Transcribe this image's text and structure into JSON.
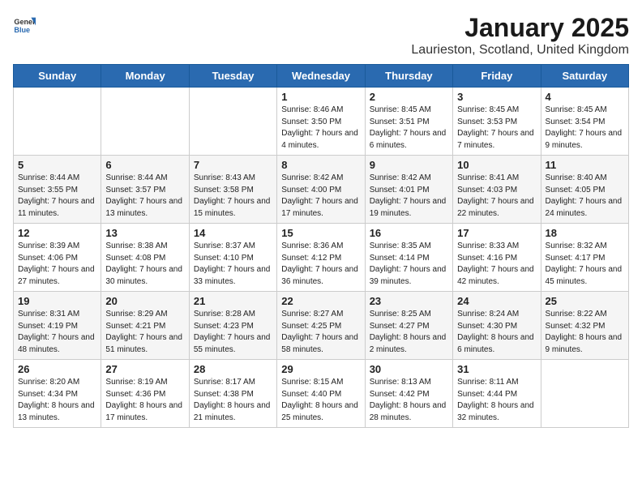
{
  "logo": {
    "general": "General",
    "blue": "Blue"
  },
  "header": {
    "title": "January 2025",
    "subtitle": "Laurieston, Scotland, United Kingdom"
  },
  "weekdays": [
    "Sunday",
    "Monday",
    "Tuesday",
    "Wednesday",
    "Thursday",
    "Friday",
    "Saturday"
  ],
  "weeks": [
    [
      {
        "day": "",
        "info": ""
      },
      {
        "day": "",
        "info": ""
      },
      {
        "day": "",
        "info": ""
      },
      {
        "day": "1",
        "info": "Sunrise: 8:46 AM\nSunset: 3:50 PM\nDaylight: 7 hours and 4 minutes."
      },
      {
        "day": "2",
        "info": "Sunrise: 8:45 AM\nSunset: 3:51 PM\nDaylight: 7 hours and 6 minutes."
      },
      {
        "day": "3",
        "info": "Sunrise: 8:45 AM\nSunset: 3:53 PM\nDaylight: 7 hours and 7 minutes."
      },
      {
        "day": "4",
        "info": "Sunrise: 8:45 AM\nSunset: 3:54 PM\nDaylight: 7 hours and 9 minutes."
      }
    ],
    [
      {
        "day": "5",
        "info": "Sunrise: 8:44 AM\nSunset: 3:55 PM\nDaylight: 7 hours and 11 minutes."
      },
      {
        "day": "6",
        "info": "Sunrise: 8:44 AM\nSunset: 3:57 PM\nDaylight: 7 hours and 13 minutes."
      },
      {
        "day": "7",
        "info": "Sunrise: 8:43 AM\nSunset: 3:58 PM\nDaylight: 7 hours and 15 minutes."
      },
      {
        "day": "8",
        "info": "Sunrise: 8:42 AM\nSunset: 4:00 PM\nDaylight: 7 hours and 17 minutes."
      },
      {
        "day": "9",
        "info": "Sunrise: 8:42 AM\nSunset: 4:01 PM\nDaylight: 7 hours and 19 minutes."
      },
      {
        "day": "10",
        "info": "Sunrise: 8:41 AM\nSunset: 4:03 PM\nDaylight: 7 hours and 22 minutes."
      },
      {
        "day": "11",
        "info": "Sunrise: 8:40 AM\nSunset: 4:05 PM\nDaylight: 7 hours and 24 minutes."
      }
    ],
    [
      {
        "day": "12",
        "info": "Sunrise: 8:39 AM\nSunset: 4:06 PM\nDaylight: 7 hours and 27 minutes."
      },
      {
        "day": "13",
        "info": "Sunrise: 8:38 AM\nSunset: 4:08 PM\nDaylight: 7 hours and 30 minutes."
      },
      {
        "day": "14",
        "info": "Sunrise: 8:37 AM\nSunset: 4:10 PM\nDaylight: 7 hours and 33 minutes."
      },
      {
        "day": "15",
        "info": "Sunrise: 8:36 AM\nSunset: 4:12 PM\nDaylight: 7 hours and 36 minutes."
      },
      {
        "day": "16",
        "info": "Sunrise: 8:35 AM\nSunset: 4:14 PM\nDaylight: 7 hours and 39 minutes."
      },
      {
        "day": "17",
        "info": "Sunrise: 8:33 AM\nSunset: 4:16 PM\nDaylight: 7 hours and 42 minutes."
      },
      {
        "day": "18",
        "info": "Sunrise: 8:32 AM\nSunset: 4:17 PM\nDaylight: 7 hours and 45 minutes."
      }
    ],
    [
      {
        "day": "19",
        "info": "Sunrise: 8:31 AM\nSunset: 4:19 PM\nDaylight: 7 hours and 48 minutes."
      },
      {
        "day": "20",
        "info": "Sunrise: 8:29 AM\nSunset: 4:21 PM\nDaylight: 7 hours and 51 minutes."
      },
      {
        "day": "21",
        "info": "Sunrise: 8:28 AM\nSunset: 4:23 PM\nDaylight: 7 hours and 55 minutes."
      },
      {
        "day": "22",
        "info": "Sunrise: 8:27 AM\nSunset: 4:25 PM\nDaylight: 7 hours and 58 minutes."
      },
      {
        "day": "23",
        "info": "Sunrise: 8:25 AM\nSunset: 4:27 PM\nDaylight: 8 hours and 2 minutes."
      },
      {
        "day": "24",
        "info": "Sunrise: 8:24 AM\nSunset: 4:30 PM\nDaylight: 8 hours and 6 minutes."
      },
      {
        "day": "25",
        "info": "Sunrise: 8:22 AM\nSunset: 4:32 PM\nDaylight: 8 hours and 9 minutes."
      }
    ],
    [
      {
        "day": "26",
        "info": "Sunrise: 8:20 AM\nSunset: 4:34 PM\nDaylight: 8 hours and 13 minutes."
      },
      {
        "day": "27",
        "info": "Sunrise: 8:19 AM\nSunset: 4:36 PM\nDaylight: 8 hours and 17 minutes."
      },
      {
        "day": "28",
        "info": "Sunrise: 8:17 AM\nSunset: 4:38 PM\nDaylight: 8 hours and 21 minutes."
      },
      {
        "day": "29",
        "info": "Sunrise: 8:15 AM\nSunset: 4:40 PM\nDaylight: 8 hours and 25 minutes."
      },
      {
        "day": "30",
        "info": "Sunrise: 8:13 AM\nSunset: 4:42 PM\nDaylight: 8 hours and 28 minutes."
      },
      {
        "day": "31",
        "info": "Sunrise: 8:11 AM\nSunset: 4:44 PM\nDaylight: 8 hours and 32 minutes."
      },
      {
        "day": "",
        "info": ""
      }
    ]
  ]
}
